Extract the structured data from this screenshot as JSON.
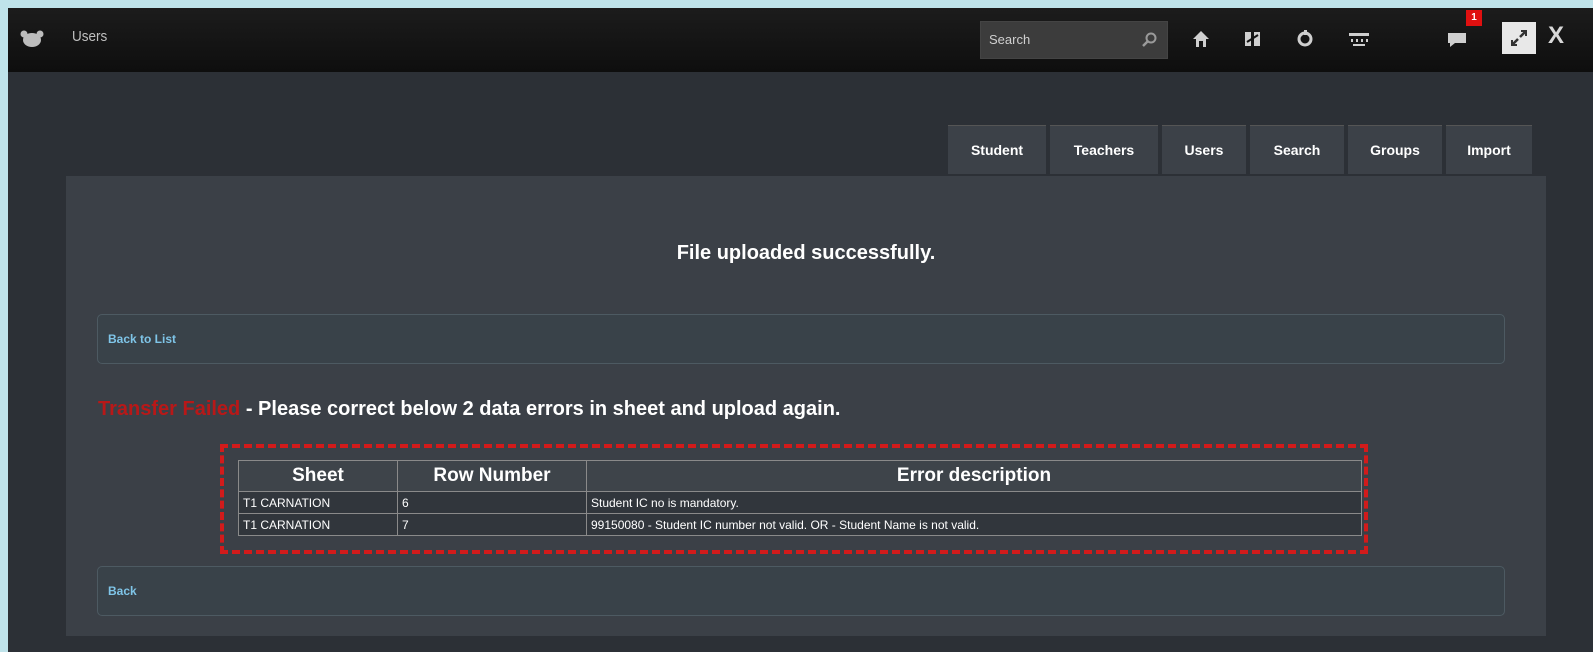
{
  "app": {
    "title": "Users"
  },
  "search": {
    "placeholder": "Search"
  },
  "notifications": {
    "count": "1"
  },
  "tabs": [
    {
      "label": "Student"
    },
    {
      "label": "Teachers"
    },
    {
      "label": "Users"
    },
    {
      "label": "Search"
    },
    {
      "label": "Groups"
    },
    {
      "label": "Import"
    }
  ],
  "main": {
    "success_message": "File uploaded successfully.",
    "back_to_list": "Back to List",
    "error_prefix": "Transfer Failed",
    "error_message": " - Please correct below 2 data errors in sheet and upload again.",
    "back": "Back"
  },
  "error_table": {
    "headers": [
      "Sheet",
      "Row Number",
      "Error description"
    ],
    "rows": [
      [
        "T1 CARNATION",
        "6",
        "Student IC no is mandatory."
      ],
      [
        "T1 CARNATION",
        "7",
        "99150080 - Student IC number not valid. OR - Student Name is not valid."
      ]
    ]
  },
  "colors": {
    "error_red": "#b81818",
    "link": "#7fc5e8",
    "background": "#2c3036"
  }
}
